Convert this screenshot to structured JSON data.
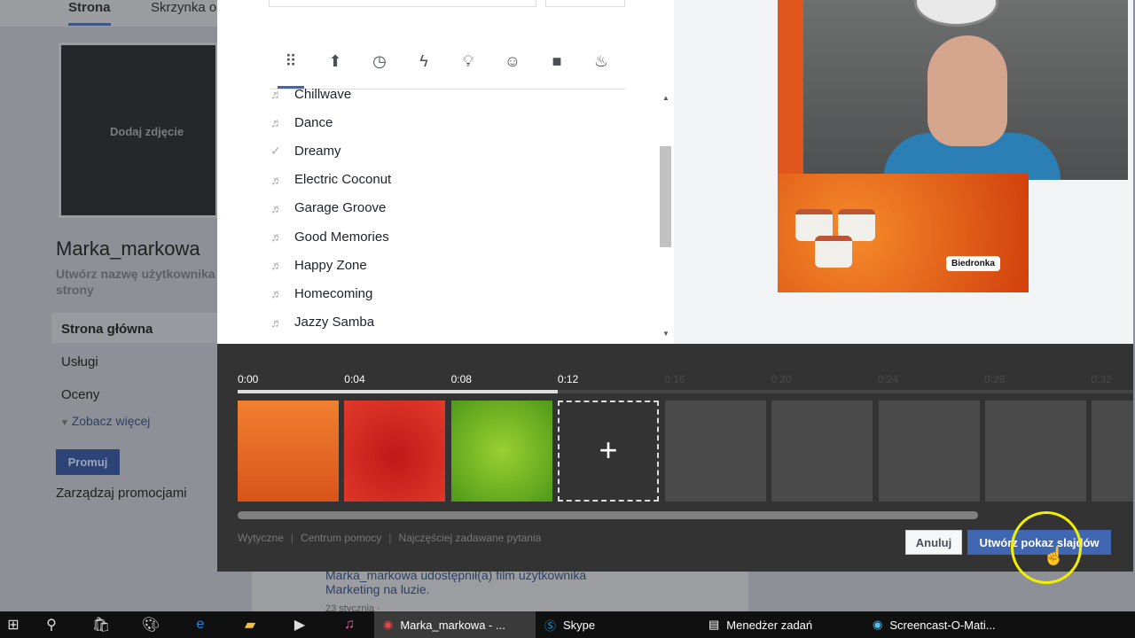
{
  "background_page": {
    "tabs": [
      "Strona",
      "Skrzynka o"
    ],
    "add_photo": "Dodaj zdjęcie",
    "page_name": "Marka_markowa",
    "username_prompt": "Utwórz nazwę użytkownika strony",
    "nav": [
      "Strona główna",
      "Usługi",
      "Oceny"
    ],
    "see_more": "Zobacz więcej",
    "promote": "Promuj",
    "manage_promotions": "Zarządzaj promocjami",
    "feed": {
      "author_line": "Marka_markowa udostępnił(a) film użytkownika",
      "text": "Marketing na luzie.",
      "date": "23 stycznia · "
    }
  },
  "music": {
    "categories": [
      "all-grid-icon",
      "upload-icon",
      "clock-icon",
      "lightning-icon",
      "lightbulb-icon",
      "smiley-icon",
      "briefcase-icon",
      "fire-icon"
    ],
    "tracks": [
      {
        "name": "Chillwave",
        "icon": "music-note"
      },
      {
        "name": "Dance",
        "icon": "music-note"
      },
      {
        "name": "Dreamy",
        "icon": "check"
      },
      {
        "name": "Electric Coconut",
        "icon": "music-note"
      },
      {
        "name": "Garage Groove",
        "icon": "music-note"
      },
      {
        "name": "Good Memories",
        "icon": "music-note"
      },
      {
        "name": "Happy Zone",
        "icon": "music-note"
      },
      {
        "name": "Homecoming",
        "icon": "music-note"
      },
      {
        "name": "Jazzy Samba",
        "icon": "music-note"
      }
    ]
  },
  "preview": {
    "brand_logo": "Biedronka"
  },
  "timeline": {
    "ticks": [
      "0:00",
      "0:04",
      "0:08",
      "0:12",
      "0:16",
      "0:20",
      "0:24",
      "0:28",
      "0:32"
    ],
    "progress_seconds": 12,
    "slides": [
      "carrot",
      "tomato",
      "cucumber"
    ],
    "add_label": "+"
  },
  "footer": {
    "links": [
      "Wytyczne",
      "Centrum pomocy",
      "Najczęściej zadawane pytania"
    ],
    "cancel": "Anuluj",
    "create": "Utwórz pokaz slajdów"
  },
  "taskbar": {
    "apps": [
      {
        "label": "Marka_markowa - ...",
        "active": true
      },
      {
        "label": "Skype"
      },
      {
        "label": "Menedżer zadań"
      },
      {
        "label": "Screencast-O-Mati..."
      }
    ]
  }
}
